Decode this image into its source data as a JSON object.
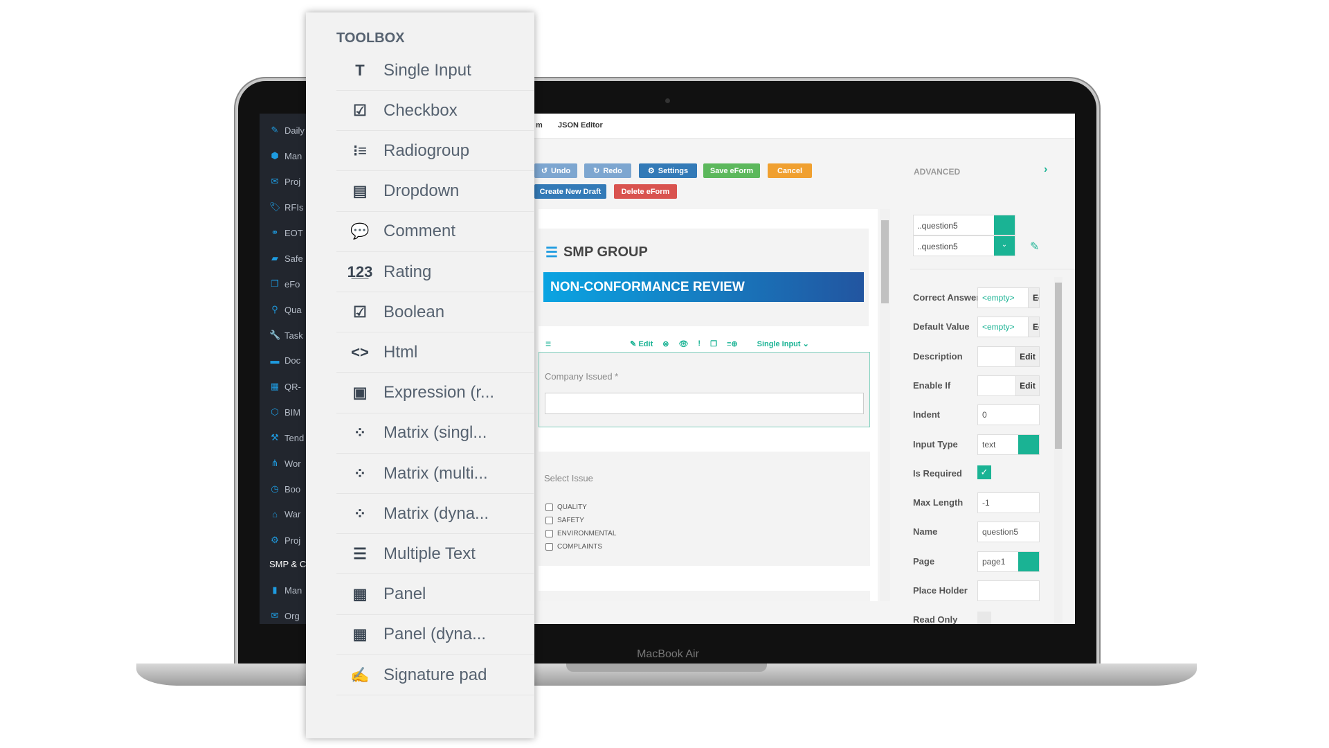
{
  "device_label": "MacBook Air",
  "sidebar": {
    "items": [
      {
        "icon": "edit-icon",
        "label": "Daily"
      },
      {
        "icon": "cubes-icon",
        "label": "Man"
      },
      {
        "icon": "envelope-icon",
        "label": "Proj"
      },
      {
        "icon": "tag-icon",
        "label": "RFIs"
      },
      {
        "icon": "handshake-icon",
        "label": "EOT"
      },
      {
        "icon": "briefcase-icon",
        "label": "Safe"
      },
      {
        "icon": "file-icon",
        "label": "eFo"
      },
      {
        "icon": "map-marker-icon",
        "label": "Qua"
      },
      {
        "icon": "wrench-icon",
        "label": "Task"
      },
      {
        "icon": "book-icon",
        "label": "Doc"
      },
      {
        "icon": "qrcode-icon",
        "label": "QR-"
      },
      {
        "icon": "cube-icon",
        "label": "BIM"
      },
      {
        "icon": "gavel-icon",
        "label": "Tend"
      },
      {
        "icon": "sitemap-icon",
        "label": "Wor"
      },
      {
        "icon": "clock-icon",
        "label": "Boo"
      },
      {
        "icon": "home-icon",
        "label": "War"
      },
      {
        "icon": "gear-icon",
        "label": "Proj"
      }
    ],
    "section": "SMP & C",
    "section_items": [
      {
        "icon": "building-icon",
        "label": "Man"
      },
      {
        "icon": "envelope-icon",
        "label": "Org"
      }
    ]
  },
  "tabs": {
    "partial": "m",
    "json_editor": "JSON Editor"
  },
  "toolbar": {
    "undo": "Undo",
    "redo": "Redo",
    "settings": "Settings",
    "save": "Save eForm",
    "cancel": "Cancel",
    "create_draft": "Create New Draft",
    "delete": "Delete eForm"
  },
  "colors": {
    "accent": "#1ab394",
    "blue": "#337ab7",
    "green": "#5cb85c",
    "orange": "#f0a030",
    "red": "#d9534f",
    "sidebar_icon": "#1e9be0"
  },
  "form": {
    "company": "SMP GROUP",
    "title": "NON-CONFORMANCE REVIEW",
    "question_toolbar": {
      "edit": "Edit",
      "type": "Single Input"
    },
    "question1": {
      "label": "Company Issued *",
      "value": ""
    },
    "question2": {
      "label": "Select Issue",
      "options": [
        "QUALITY",
        "SAFETY",
        "ENVIRONMENTAL",
        "COMPLAINTS"
      ]
    }
  },
  "properties": {
    "header": "ADVANCED",
    "selector1": "..question5",
    "selector2": "..question5",
    "rows": [
      {
        "label": "Correct Answer",
        "value": "<empty>",
        "button": "Ec"
      },
      {
        "label": "Default Value",
        "value": "<empty>",
        "button": "Ec"
      },
      {
        "label": "Description",
        "value": "",
        "button": "Edit"
      },
      {
        "label": "Enable If",
        "value": "",
        "button": "Edit"
      },
      {
        "label": "Indent",
        "value": "0"
      },
      {
        "label": "Input Type",
        "value": "text"
      },
      {
        "label": "Is Required",
        "checked": true
      },
      {
        "label": "Max Length",
        "value": "-1"
      },
      {
        "label": "Name",
        "value": "question5"
      },
      {
        "label": "Page",
        "value": "page1"
      },
      {
        "label": "Place Holder",
        "value": ""
      },
      {
        "label": "Read Only",
        "checked": false
      }
    ]
  },
  "toolbox": {
    "title": "TOOLBOX",
    "items": [
      {
        "icon": "text-icon",
        "glyph": "T",
        "label": "Single Input"
      },
      {
        "icon": "checkbox-icon",
        "glyph": "☑",
        "label": "Checkbox"
      },
      {
        "icon": "radiogroup-icon",
        "glyph": "⁝≡",
        "label": "Radiogroup"
      },
      {
        "icon": "dropdown-icon",
        "glyph": "▤",
        "label": "Dropdown"
      },
      {
        "icon": "comment-icon",
        "glyph": "💬",
        "label": "Comment"
      },
      {
        "icon": "rating-icon",
        "glyph": "1̲2̲3",
        "label": "Rating"
      },
      {
        "icon": "boolean-icon",
        "glyph": "☑",
        "label": "Boolean"
      },
      {
        "icon": "html-icon",
        "glyph": "<>",
        "label": "Html"
      },
      {
        "icon": "expression-icon",
        "glyph": "▣",
        "label": "Expression (r..."
      },
      {
        "icon": "matrix-single-icon",
        "glyph": "⁘",
        "label": "Matrix (singl..."
      },
      {
        "icon": "matrix-multi-icon",
        "glyph": "⁘",
        "label": "Matrix (multi..."
      },
      {
        "icon": "matrix-dynamic-icon",
        "glyph": "⁘",
        "label": "Matrix (dyna..."
      },
      {
        "icon": "multiple-text-icon",
        "glyph": "☰",
        "label": "Multiple Text"
      },
      {
        "icon": "panel-icon",
        "glyph": "▦",
        "label": "Panel"
      },
      {
        "icon": "panel-dynamic-icon",
        "glyph": "▦",
        "label": "Panel (dyna..."
      },
      {
        "icon": "signature-pad-icon",
        "glyph": "✍",
        "label": "Signature pad"
      }
    ]
  }
}
